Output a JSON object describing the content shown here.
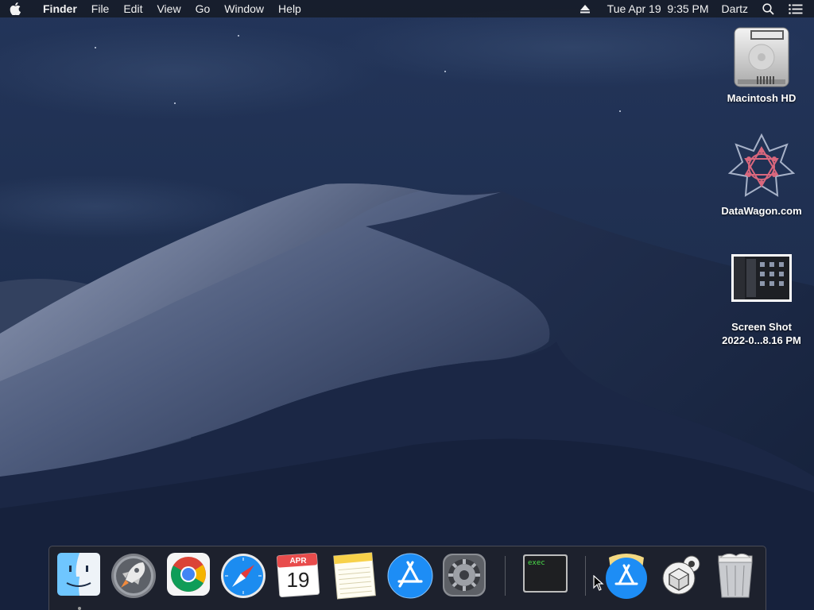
{
  "menubar": {
    "app_name": "Finder",
    "items": [
      "File",
      "Edit",
      "View",
      "Go",
      "Window",
      "Help"
    ],
    "datetime": "Tue Apr 19  9:35 PM",
    "user": "Dartz",
    "icons": [
      "apple-icon",
      "eject-icon",
      "spotlight-search-icon",
      "notification-center-icon"
    ]
  },
  "desktop": {
    "icons": [
      {
        "label": "Macintosh HD",
        "icon": "hard-drive-icon"
      },
      {
        "label": "DataWagon.com",
        "icon": "datawagon-logo-icon"
      },
      {
        "label_line1": "Screen Shot",
        "label_line2": "2022-0...8.16 PM",
        "icon": "screenshot-thumbnail-icon"
      }
    ]
  },
  "dock": {
    "items": [
      {
        "name": "Finder",
        "icon": "finder-icon",
        "running": true
      },
      {
        "name": "Launchpad",
        "icon": "launchpad-rocket-icon"
      },
      {
        "name": "Google Chrome",
        "icon": "chrome-icon"
      },
      {
        "name": "Safari",
        "icon": "safari-compass-icon"
      },
      {
        "name": "Calendar",
        "icon": "calendar-icon",
        "month": "APR",
        "day": "19"
      },
      {
        "name": "Notes",
        "icon": "notes-icon"
      },
      {
        "name": "App Store",
        "icon": "app-store-icon"
      },
      {
        "name": "System Preferences",
        "icon": "system-preferences-gear-icon"
      },
      {
        "name": "Terminal",
        "icon": "terminal-icon",
        "text": "exec"
      },
      {
        "name": "App Store Downloads",
        "icon": "app-store-folder-icon"
      },
      {
        "name": "Utility",
        "icon": "gears-cube-icon"
      },
      {
        "name": "Trash",
        "icon": "trash-full-icon"
      }
    ]
  },
  "colors": {
    "menubar_bg": "#14181f",
    "wallpaper_sky": "#1f2f4f",
    "dune_light": "#8e9ab4",
    "dune_dark": "#1a2745"
  }
}
